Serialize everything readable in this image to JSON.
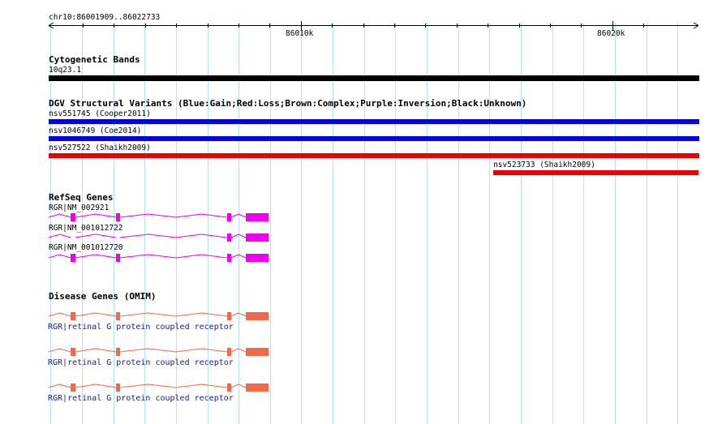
{
  "ruler": {
    "region": "chr10:86001909..86022733",
    "ticks": [
      "86010k",
      "86020k"
    ]
  },
  "tracks": {
    "cytoband": {
      "title": "Cytogenetic Bands",
      "band": "10q23.1",
      "color": "#000000"
    },
    "dgv": {
      "title": "DGV Structural Variants (Blue:Gain;Red:Loss;Brown:Complex;Purple:Inversion;Black:Unknown)",
      "variants": [
        {
          "label": "nsv551745 (Cooper2011)",
          "color": "#0000ee"
        },
        {
          "label": "nsv1046749 (Coe2014)",
          "color": "#0000ee"
        },
        {
          "label": "nsv527522 (Shaikh2009)",
          "color": "#ee0000"
        },
        {
          "label": "nsv523733 (Shaikh2009)",
          "color": "#ee0000"
        }
      ]
    },
    "refseq": {
      "title": "RefSeq Genes",
      "color": "#ee00ee",
      "transcripts": [
        {
          "label": "RGR|NM_002921"
        },
        {
          "label": "RGR|NM_001012722"
        },
        {
          "label": "RGR|NM_001012720"
        }
      ]
    },
    "omim": {
      "title": "Disease Genes (OMIM)",
      "color": "#f4684a",
      "genes": [
        {
          "label": "RGR|retinal G protein coupled receptor"
        },
        {
          "label": "RGR|retinal G protein coupled receptor"
        },
        {
          "label": "RGR|retinal G protein coupled receptor"
        }
      ]
    }
  }
}
